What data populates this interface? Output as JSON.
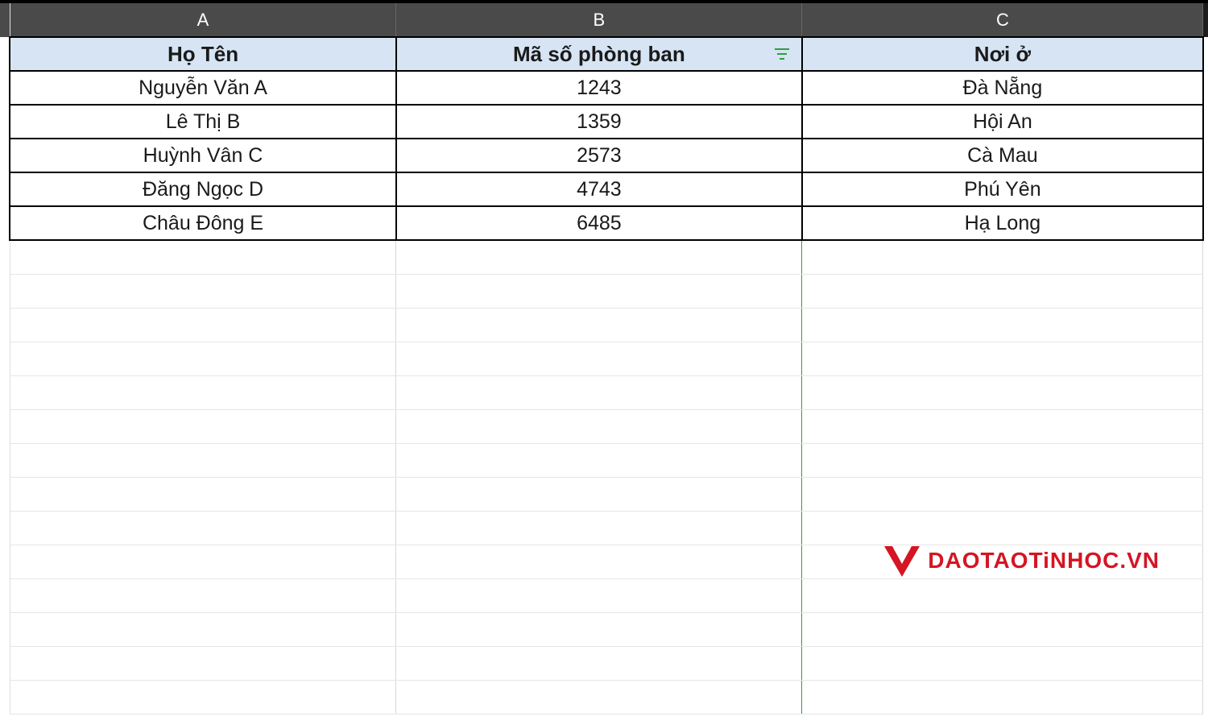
{
  "columns": {
    "A": "A",
    "B": "B",
    "C": "C"
  },
  "headers": {
    "A": "Họ Tên",
    "B": "Mã số phòng ban",
    "C": "Nơi ở"
  },
  "rows": [
    {
      "A": "Nguyễn Văn A",
      "B": "1243",
      "C": "Đà Nẵng"
    },
    {
      "A": "Lê Thị B",
      "B": "1359",
      "C": "Hội An"
    },
    {
      "A": "Huỳnh Vân C",
      "B": "2573",
      "C": "Cà Mau"
    },
    {
      "A": "Đăng Ngọc D",
      "B": "4743",
      "C": "Phú Yên"
    },
    {
      "A": "Châu Đông E",
      "B": "6485",
      "C": "Hạ Long"
    }
  ],
  "filter_icon": "filter-icon",
  "watermark": {
    "text": "DAOTAOTiNHOC.VN",
    "color": "#d51523"
  }
}
